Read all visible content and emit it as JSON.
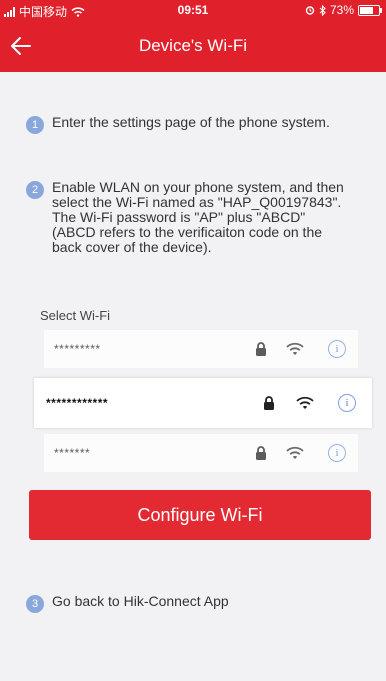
{
  "status_bar": {
    "carrier": "中国移动",
    "time": "09:51",
    "battery": "73%",
    "battery_level": 0.73
  },
  "header": {
    "title": "Device's Wi-Fi"
  },
  "steps": [
    {
      "number": "1",
      "text": "Enter the settings page of the phone system."
    },
    {
      "number": "2",
      "text": "Enable WLAN on your phone system, and then select the Wi-Fi named as \"HAP_Q00197843\". The Wi-Fi password is \"AP\" plus \"ABCD\" (ABCD refers to the verificaiton code on the back cover of the device)."
    },
    {
      "number": "3",
      "text": "Go back to Hik-Connect App"
    }
  ],
  "wifi_list": {
    "label": "Select Wi-Fi",
    "networks": [
      {
        "name": "*********"
      },
      {
        "name": "************"
      },
      {
        "name": "*******"
      }
    ]
  },
  "configure_button": "Configure Wi-Fi",
  "colors": {
    "accent": "#e0202a",
    "button": "#e32a32",
    "step_badge": "#8aa7dc",
    "info_icon": "#5f82d6"
  },
  "icons": {
    "back": "arrow-left-icon",
    "lock": "lock-icon",
    "wifi": "wifi-icon",
    "info": "info-icon"
  }
}
